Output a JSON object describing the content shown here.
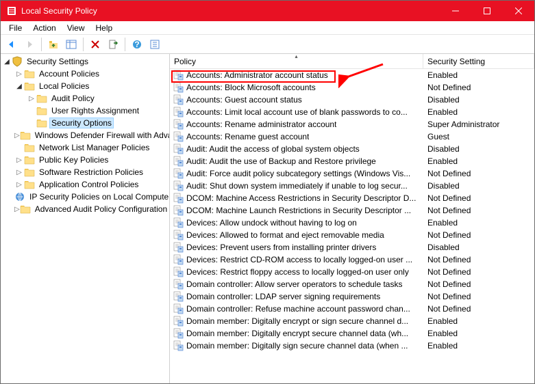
{
  "window": {
    "title": "Local Security Policy"
  },
  "menubar": {
    "items": [
      "File",
      "Action",
      "View",
      "Help"
    ]
  },
  "tree": {
    "root": {
      "label": "Security Settings"
    },
    "items": [
      {
        "label": "Account Policies",
        "depth": 1,
        "twisty": "▷",
        "icon": "folder"
      },
      {
        "label": "Local Policies",
        "depth": 1,
        "twisty": "◢",
        "icon": "folder"
      },
      {
        "label": "Audit Policy",
        "depth": 2,
        "twisty": "▷",
        "icon": "folder"
      },
      {
        "label": "User Rights Assignment",
        "depth": 2,
        "twisty": "",
        "icon": "folder"
      },
      {
        "label": "Security Options",
        "depth": 2,
        "twisty": "",
        "icon": "folder",
        "selected": true
      },
      {
        "label": "Windows Defender Firewall with Advanced Security",
        "depth": 1,
        "twisty": "▷",
        "icon": "folder"
      },
      {
        "label": "Network List Manager Policies",
        "depth": 1,
        "twisty": "",
        "icon": "folder"
      },
      {
        "label": "Public Key Policies",
        "depth": 1,
        "twisty": "▷",
        "icon": "folder"
      },
      {
        "label": "Software Restriction Policies",
        "depth": 1,
        "twisty": "▷",
        "icon": "folder"
      },
      {
        "label": "Application Control Policies",
        "depth": 1,
        "twisty": "▷",
        "icon": "folder"
      },
      {
        "label": "IP Security Policies on Local Computer",
        "depth": 1,
        "twisty": "",
        "icon": "ipsec"
      },
      {
        "label": "Advanced Audit Policy Configuration",
        "depth": 1,
        "twisty": "▷",
        "icon": "folder"
      }
    ]
  },
  "list": {
    "columns": {
      "policy": "Policy",
      "setting": "Security Setting"
    },
    "rows": [
      {
        "policy": "Accounts: Administrator account status",
        "setting": "Enabled",
        "highlighted": true
      },
      {
        "policy": "Accounts: Block Microsoft accounts",
        "setting": "Not Defined"
      },
      {
        "policy": "Accounts: Guest account status",
        "setting": "Disabled"
      },
      {
        "policy": "Accounts: Limit local account use of blank passwords to co...",
        "setting": "Enabled"
      },
      {
        "policy": "Accounts: Rename administrator account",
        "setting": "Super Administrator"
      },
      {
        "policy": "Accounts: Rename guest account",
        "setting": "Guest"
      },
      {
        "policy": "Audit: Audit the access of global system objects",
        "setting": "Disabled"
      },
      {
        "policy": "Audit: Audit the use of Backup and Restore privilege",
        "setting": "Enabled"
      },
      {
        "policy": "Audit: Force audit policy subcategory settings (Windows Vis...",
        "setting": "Not Defined"
      },
      {
        "policy": "Audit: Shut down system immediately if unable to log secur...",
        "setting": "Disabled"
      },
      {
        "policy": "DCOM: Machine Access Restrictions in Security Descriptor D...",
        "setting": "Not Defined"
      },
      {
        "policy": "DCOM: Machine Launch Restrictions in Security Descriptor ...",
        "setting": "Not Defined"
      },
      {
        "policy": "Devices: Allow undock without having to log on",
        "setting": "Enabled"
      },
      {
        "policy": "Devices: Allowed to format and eject removable media",
        "setting": "Not Defined"
      },
      {
        "policy": "Devices: Prevent users from installing printer drivers",
        "setting": "Disabled"
      },
      {
        "policy": "Devices: Restrict CD-ROM access to locally logged-on user ...",
        "setting": "Not Defined"
      },
      {
        "policy": "Devices: Restrict floppy access to locally logged-on user only",
        "setting": "Not Defined"
      },
      {
        "policy": "Domain controller: Allow server operators to schedule tasks",
        "setting": "Not Defined"
      },
      {
        "policy": "Domain controller: LDAP server signing requirements",
        "setting": "Not Defined"
      },
      {
        "policy": "Domain controller: Refuse machine account password chan...",
        "setting": "Not Defined"
      },
      {
        "policy": "Domain member: Digitally encrypt or sign secure channel d...",
        "setting": "Enabled"
      },
      {
        "policy": "Domain member: Digitally encrypt secure channel data (wh...",
        "setting": "Enabled"
      },
      {
        "policy": "Domain member: Digitally sign secure channel data (when ...",
        "setting": "Enabled"
      }
    ]
  }
}
